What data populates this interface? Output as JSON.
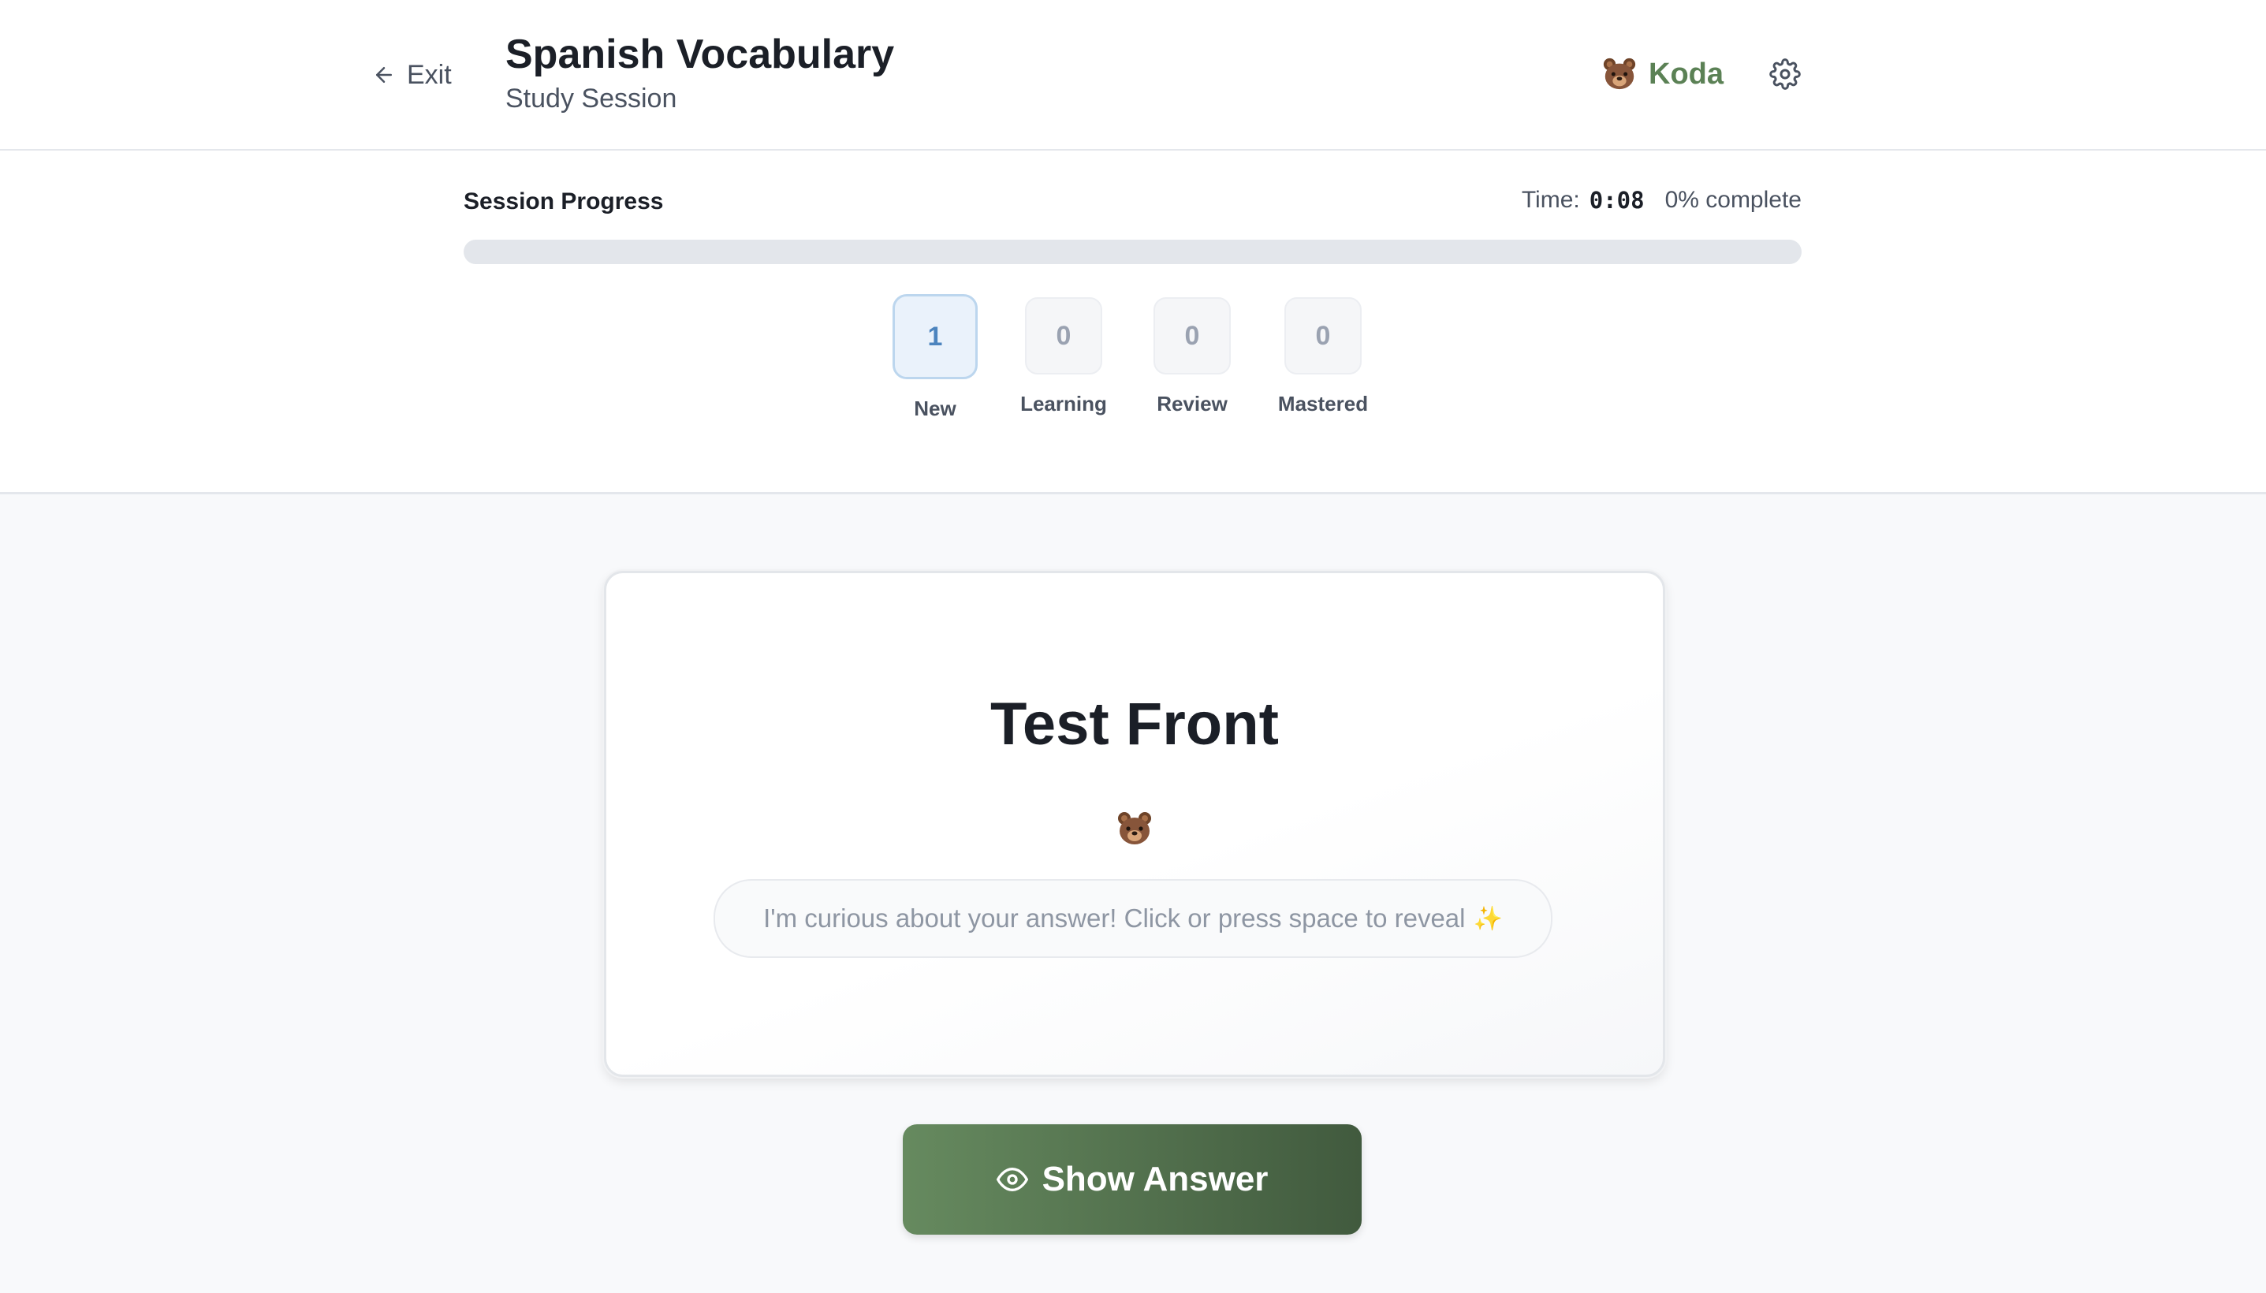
{
  "header": {
    "exit_label": "Exit",
    "title": "Spanish Vocabulary",
    "subtitle": "Study Session",
    "mascot_name": "Koda",
    "mascot_icon": "bear-icon",
    "settings_icon": "gear-icon"
  },
  "progress": {
    "label": "Session Progress",
    "time_label": "Time:",
    "time_value": "0:08",
    "complete_text": "0% complete",
    "percent": 0
  },
  "stats": [
    {
      "count": "1",
      "label": "New",
      "active": true
    },
    {
      "count": "0",
      "label": "Learning",
      "active": false
    },
    {
      "count": "0",
      "label": "Review",
      "active": false
    },
    {
      "count": "0",
      "label": "Mastered",
      "active": false
    }
  ],
  "card": {
    "front": "Test Front",
    "hint": "I'm curious about your answer! Click or press space to reveal",
    "hint_emoji": "✨"
  },
  "actions": {
    "show_answer_label": "Show Answer",
    "show_answer_icon": "eye-icon"
  },
  "colors": {
    "accent": "#5b8155",
    "button_start": "#668a5f",
    "button_end": "#415a3e",
    "new_highlight": "#4c84be"
  }
}
